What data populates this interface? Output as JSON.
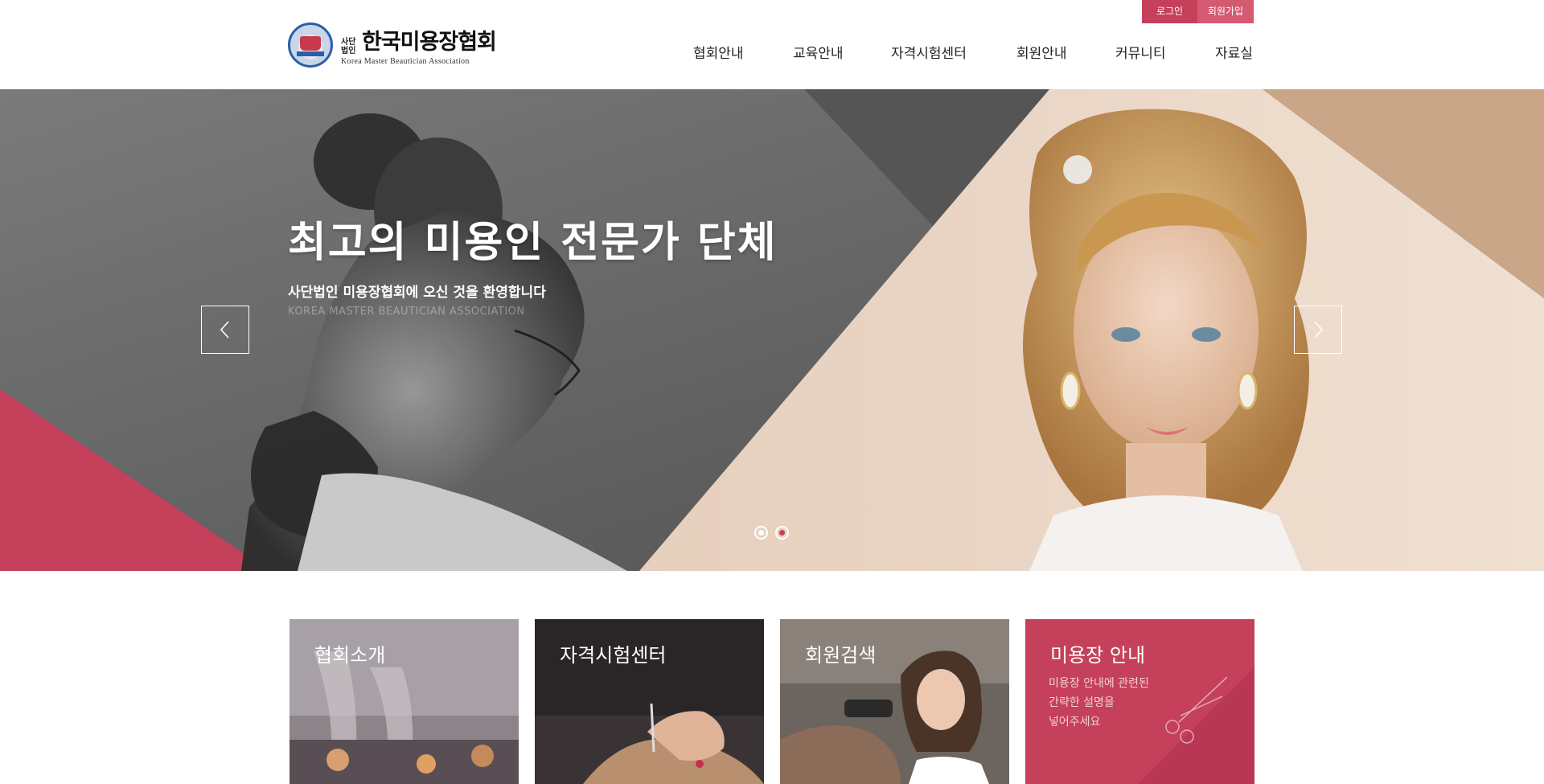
{
  "header": {
    "util": {
      "login": "로그인",
      "join": "회원가입"
    },
    "logo": {
      "small": "사단\n법인",
      "name": "한국미용장협회",
      "english": "Korea Master Beautician Association"
    },
    "nav": [
      "협회안내",
      "교육안내",
      "자격시험센터",
      "회원안내",
      "커뮤니티",
      "자료실"
    ]
  },
  "hero": {
    "title": "최고의 미용인 전문가 단체",
    "subtitle": "사단법인 미용장협회에 오신 것을 환영합니다",
    "english": "KOREA MASTER BEAUTICIAN ASSOCIATION",
    "slides": 2,
    "active_slide": 2
  },
  "cards": [
    {
      "label": "협회소개"
    },
    {
      "label": "자격시험센터"
    },
    {
      "label": "회원검색"
    },
    {
      "label": "미용장 안내",
      "desc": [
        "미용장 안내에 관련된",
        "간략한 설명을",
        "넣어주세요"
      ]
    }
  ],
  "colors": {
    "accent": "#c5405a",
    "accent_light": "#d45a72",
    "beige": "#d9b9a2",
    "dark_grey": "#5a5a5a"
  }
}
